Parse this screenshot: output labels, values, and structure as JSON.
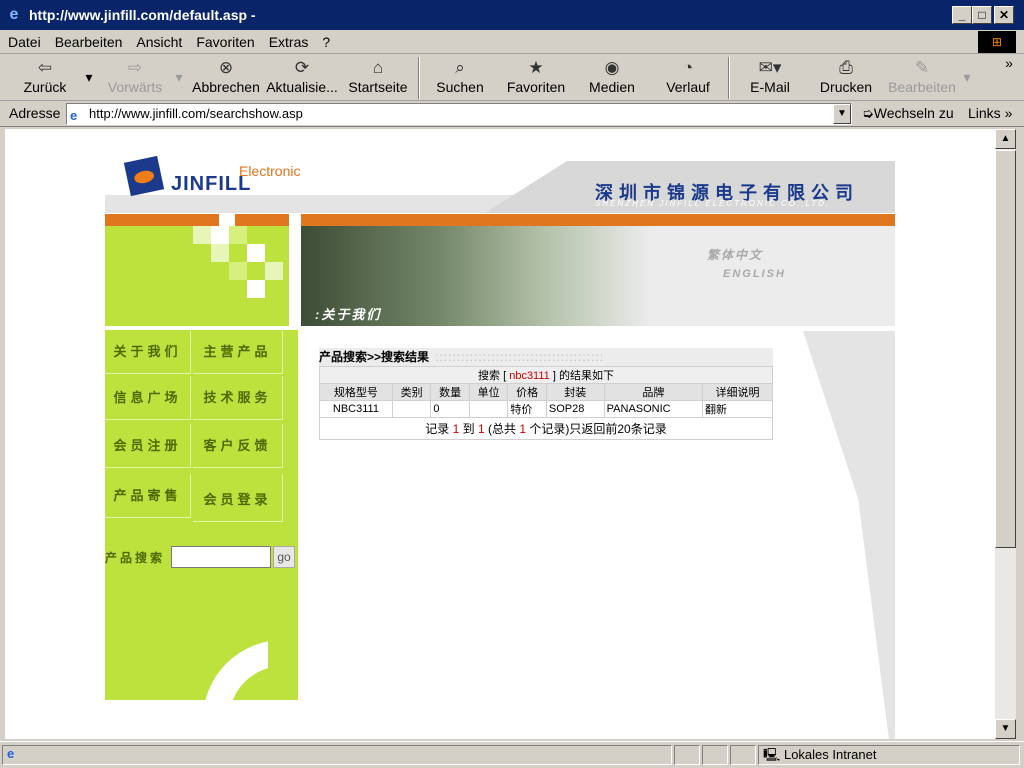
{
  "window": {
    "title": "http://www.jinfill.com/default.asp -"
  },
  "menu": [
    "Datei",
    "Bearbeiten",
    "Ansicht",
    "Favoriten",
    "Extras",
    "?"
  ],
  "toolbar": {
    "back": "Zurück",
    "forward": "Vorwärts",
    "stop": "Abbrechen",
    "refresh": "Aktualisie...",
    "home": "Startseite",
    "search": "Suchen",
    "favorites": "Favoriten",
    "media": "Medien",
    "history": "Verlauf",
    "mail": "E-Mail",
    "print": "Drucken",
    "edit": "Bearbeiten",
    "more": "»"
  },
  "address": {
    "label": "Adresse",
    "url": "http://www.jinfill.com/searchshow.asp",
    "go": "Wechseln zu",
    "links": "Links »"
  },
  "status": {
    "zone": "Lokales Intranet"
  },
  "site": {
    "logo": "JINFILL",
    "logo_tag": "Electronic",
    "company": "深圳市锦源电子有限公司",
    "company_en": "SHENZHEN JINFILL ELECTRONIC CO.,LTD.",
    "banner_label": ":关于我们",
    "lang_cn": "繁体中文",
    "lang_en": "ENGLISH",
    "nav": [
      "关于我们",
      "主营产品",
      "信息广场",
      "技术服务",
      "会员注册",
      "客户反馈",
      "产品寄售",
      "会员登录"
    ],
    "search_label": "产品搜索",
    "search_go": "go",
    "search_value": ""
  },
  "results": {
    "caption": "产品搜索>>搜索结果",
    "caption_dots": ":::::::::::::::::::::::::::::::::::::::",
    "query_prefix": "搜索 [",
    "query": "nbc3111",
    "query_suffix": "] 的结果如下",
    "columns": [
      "规格型号",
      "类别",
      "数量",
      "单位",
      "价格",
      "封装",
      "品牌",
      "详细说明"
    ],
    "rows": [
      [
        "NBC3111",
        "",
        "0",
        "",
        "特价",
        "SOP28",
        "PANASONIC",
        "翻新"
      ]
    ],
    "footer": {
      "p1": "记录",
      "from": "1",
      "p2": "到",
      "to": "1",
      "p3": "(总共",
      "total": "1",
      "p4": "个记录)只返回前20条记录"
    }
  }
}
